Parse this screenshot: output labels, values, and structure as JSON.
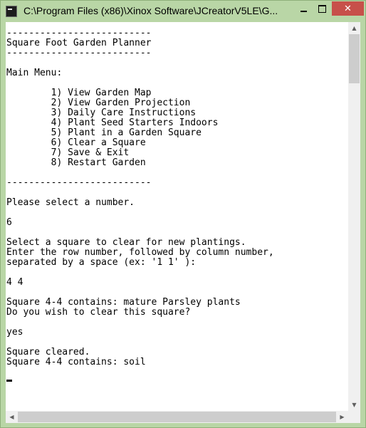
{
  "window": {
    "title": "C:\\Program Files (x86)\\Xinox Software\\JCreatorV5LE\\G...",
    "minimize_glyph": "minimize",
    "maximize_glyph": "maximize",
    "close_glyph": "✕"
  },
  "console": {
    "lines": [
      "--------------------------",
      "Square Foot Garden Planner",
      "--------------------------",
      "",
      "Main Menu:",
      "",
      "        1) View Garden Map",
      "        2) View Garden Projection",
      "        3) Daily Care Instructions",
      "        4) Plant Seed Starters Indoors",
      "        5) Plant in a Garden Square",
      "        6) Clear a Square",
      "        7) Save & Exit",
      "        8) Restart Garden",
      "",
      "--------------------------",
      "",
      "Please select a number.",
      "",
      "6",
      "",
      "Select a square to clear for new plantings.",
      "Enter the row number, followed by column number,",
      "separated by a space (ex: '1 1' ):",
      "",
      "4 4",
      "",
      "Square 4-4 contains: mature Parsley plants",
      "Do you wish to clear this square?",
      "",
      "yes",
      "",
      "Square cleared.",
      "Square 4-4 contains: soil"
    ]
  },
  "scrollbars": {
    "up_arrow": "▲",
    "down_arrow": "▼",
    "left_arrow": "◀",
    "right_arrow": "▶"
  }
}
